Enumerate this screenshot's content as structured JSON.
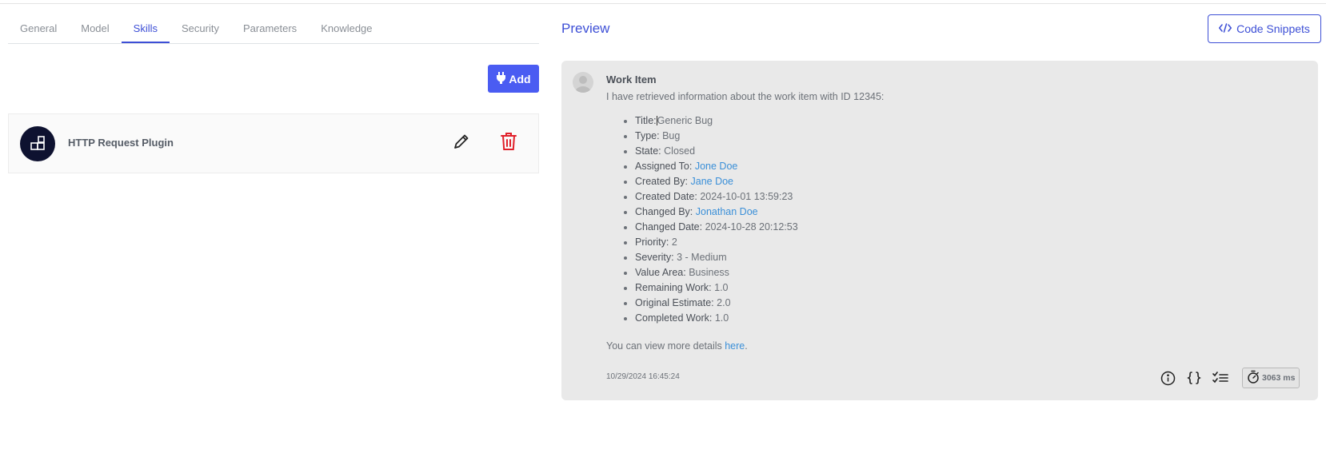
{
  "tabs": [
    "General",
    "Model",
    "Skills",
    "Security",
    "Parameters",
    "Knowledge"
  ],
  "active_tab": "Skills",
  "add_button": "Add",
  "plugin": {
    "name": "HTTP Request Plugin"
  },
  "preview": {
    "title": "Preview",
    "code_snippets_label": "Code Snippets"
  },
  "message": {
    "title": "Work Item",
    "intro": "I have retrieved information about the work item with ID 12345:",
    "items": [
      {
        "key": "Title:",
        "value": "Generic Bug"
      },
      {
        "key": "Type:",
        "value": "Bug"
      },
      {
        "key": "State:",
        "value": "Closed"
      },
      {
        "key": "Assigned To:",
        "value": "Jone Doe"
      },
      {
        "key": "Created By:",
        "value": "Jane Doe"
      },
      {
        "key": "Created Date:",
        "value": "2024-10-01 13:59:23"
      },
      {
        "key": "Changed By:",
        "value": "Jonathan Doe"
      },
      {
        "key": "Changed Date:",
        "value": "2024-10-28 20:12:53"
      },
      {
        "key": "Priority:",
        "value": "2"
      },
      {
        "key": "Severity:",
        "value": "3 - Medium"
      },
      {
        "key": "Value Area:",
        "value": "Business"
      },
      {
        "key": "Remaining Work:",
        "value": "1.0"
      },
      {
        "key": "Original Estimate:",
        "value": "2.0"
      },
      {
        "key": "Completed Work:",
        "value": "1.0"
      }
    ],
    "footer_prefix": "You can view more details ",
    "footer_link": "here",
    "footer_suffix": ".",
    "timestamp": "10/29/2024 16:45:24",
    "duration": "3063 ms"
  },
  "colors": {
    "accent": "#4a5cf2",
    "link": "#3a8fd8",
    "delete": "#e0202a"
  }
}
